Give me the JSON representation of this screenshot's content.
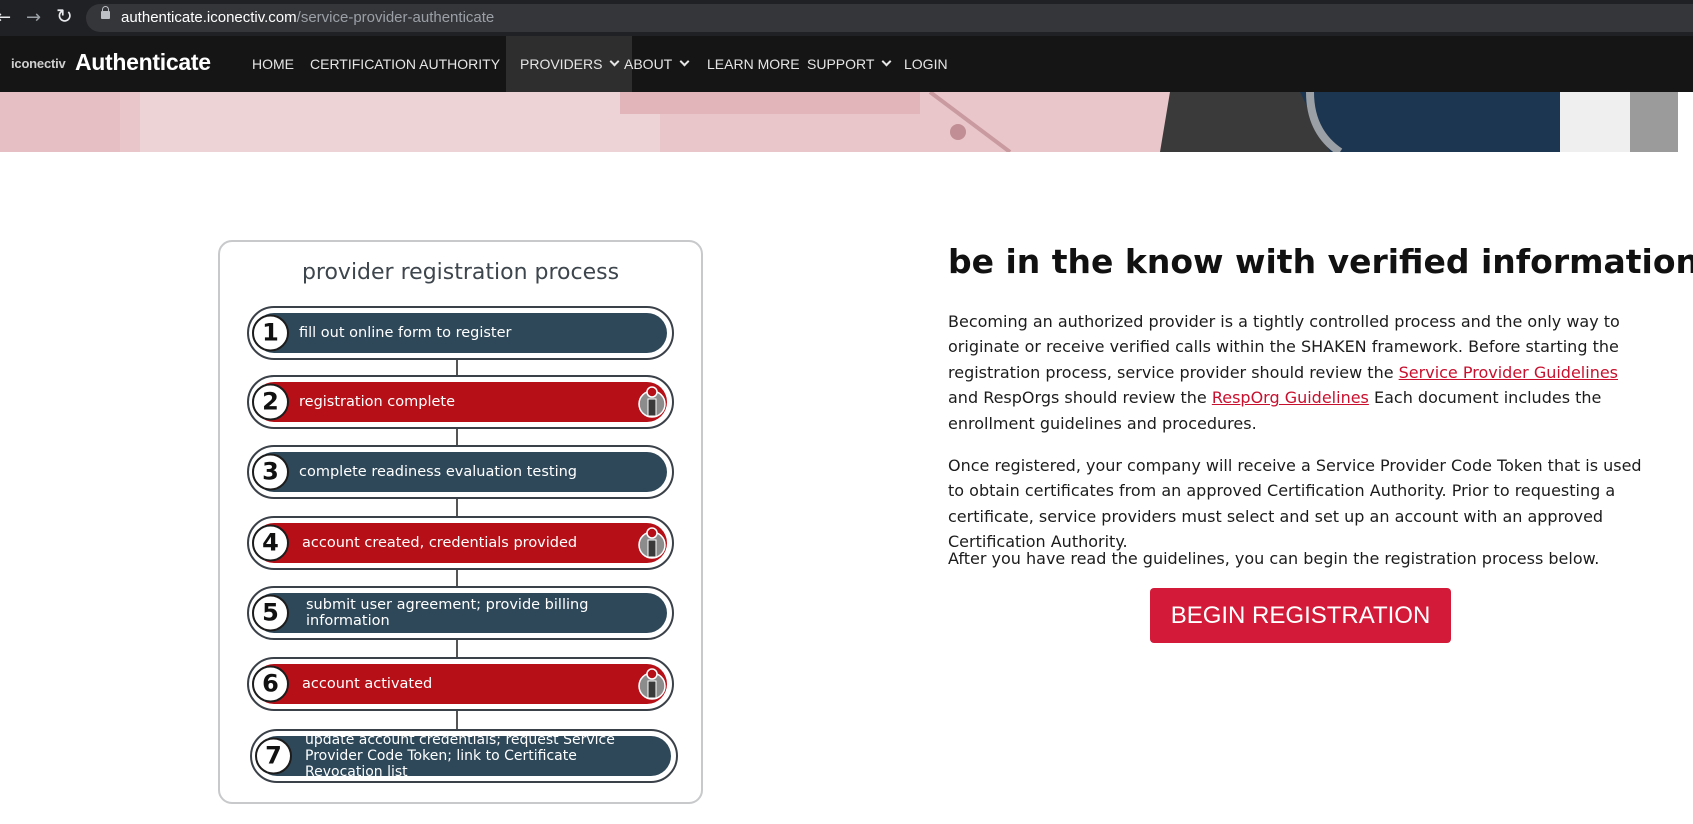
{
  "browser": {
    "back_glyph": "←",
    "forward_glyph": "→",
    "reload_glyph": "↻",
    "url_host": "authenticate.iconectiv.com",
    "url_path": "/service-provider-authenticate"
  },
  "nav": {
    "brand_small": "iconectiv",
    "brand_big": "Authenticate",
    "items": [
      {
        "label": "HOME",
        "dropdown": false
      },
      {
        "label": "CERTIFICATION AUTHORITY",
        "dropdown": true
      },
      {
        "label": "PROVIDERS",
        "dropdown": true,
        "active": true
      },
      {
        "label": "ABOUT",
        "dropdown": true
      },
      {
        "label": "LEARN MORE",
        "dropdown": false
      },
      {
        "label": "SUPPORT",
        "dropdown": true
      },
      {
        "label": "LOGIN",
        "dropdown": false
      }
    ]
  },
  "diagram": {
    "title": "provider registration process",
    "steps": [
      {
        "number": "1",
        "text": "fill out online form to register",
        "color": "#2e4859",
        "icon": null
      },
      {
        "number": "2",
        "text": "registration complete",
        "color": "#b70f17",
        "icon": "iconectiv-i-icon"
      },
      {
        "number": "3",
        "text": "complete readiness evaluation testing",
        "color": "#2e4859",
        "icon": null
      },
      {
        "number": "4",
        "text": "account created, credentials provided",
        "color": "#b70f17",
        "icon": "iconectiv-i-icon"
      },
      {
        "number": "5",
        "text": "submit user agreement; provide billing information",
        "color": "#2e4859",
        "icon": null
      },
      {
        "number": "6",
        "text": "account activated",
        "color": "#b70f17",
        "icon": "iconectiv-i-icon"
      },
      {
        "number": "7",
        "text": "update account credentials; request Service Provider Code Token; link to Certificate Revocation list",
        "color": "#2e4859",
        "icon": null
      }
    ]
  },
  "content": {
    "headline": "be in the know with verified information",
    "para1_a": "Becoming an authorized provider is a tightly controlled process and the only way to originate or receive verified calls within the SHAKEN framework. Before starting the registration process, service provider should review the ",
    "link_sp_guidelines": "Service Provider Guidelines",
    "para1_b": " and RespOrgs should review the ",
    "link_resporg_guidelines": "RespOrg Guidelines",
    "para1_c": " Each document includes the enrollment guidelines and procedures.",
    "para2": "Once registered, your company will receive a Service Provider Code Token that is used to obtain certificates from an approved Certification Authority.  Prior to requesting a certificate, service providers must select and set up an account with an approved Certification Authority.",
    "para3": "After you have read the guidelines, you can begin the registration process below.",
    "button_label": "BEGIN REGISTRATION"
  },
  "colors": {
    "accent_red": "#d31a38",
    "link_red": "#c8102e",
    "step_dark": "#2e4859",
    "step_red": "#b70f17"
  }
}
